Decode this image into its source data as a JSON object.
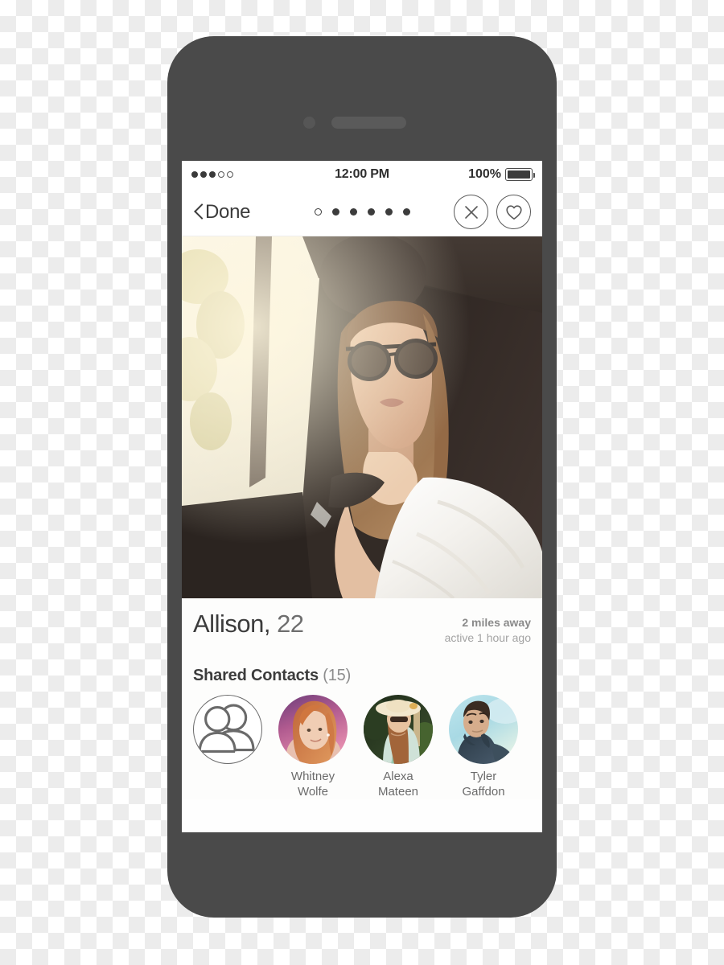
{
  "device": {
    "frame_color": "#4a4a4a",
    "camera_icon": "camera-dot",
    "speaker_icon": "speaker-grill"
  },
  "status_bar": {
    "signal_dots_total": 5,
    "signal_dots_filled": 3,
    "carrier": "",
    "time": "12:00 PM",
    "battery_percent": "100%",
    "battery_level": 100
  },
  "nav_bar": {
    "back_label": "Done",
    "back_icon": "chevron-left-icon",
    "pagination": {
      "total": 6,
      "active_index": 0
    },
    "actions": [
      {
        "name": "pass-button",
        "icon": "close-x-icon"
      },
      {
        "name": "like-button",
        "icon": "heart-icon"
      }
    ]
  },
  "profile": {
    "photo_alt": "woman-in-car-with-sunglasses",
    "name": "Allison,",
    "age": "22",
    "distance": "2 miles away",
    "last_active": "active 1 hour ago"
  },
  "shared_contacts": {
    "title": "Shared Contacts",
    "count": "(15)",
    "placeholder_icon": "two-people-icon",
    "people": [
      {
        "first": "Whitney",
        "last": "Wolfe"
      },
      {
        "first": "Alexa",
        "last": "Mateen"
      },
      {
        "first": "Tyler",
        "last": "Gaffdon"
      }
    ]
  },
  "colors": {
    "frame": "#4a4a4a",
    "text_primary": "#3c3c3c",
    "text_secondary": "#8a8a8a",
    "screen_bg": "#fdfdfc"
  }
}
